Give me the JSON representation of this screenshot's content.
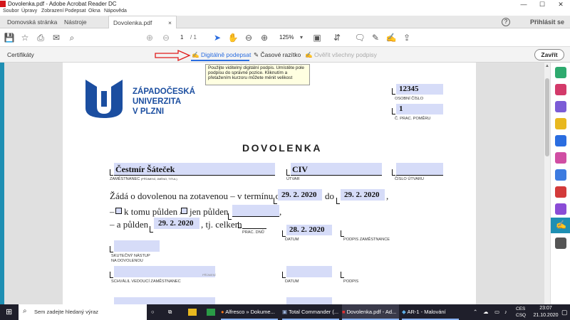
{
  "window": {
    "title": "Dovolenka.pdf - Adobe Acrobat Reader DC",
    "min": "—",
    "max": "☐",
    "close": "✕"
  },
  "menu": [
    "Soubor",
    "Úpravy",
    "Zobrazení",
    "Podepsat",
    "Okna",
    "Nápověda"
  ],
  "tabs": {
    "home": "Domovská stránka",
    "tools": "Nástroje",
    "doc": "Dovolenka.pdf",
    "doc_close": "×"
  },
  "account": {
    "help": "?",
    "signin": "Přihlásit se"
  },
  "toolbar": {
    "page_current": "1",
    "page_total": "/ 1",
    "zoom": "125%"
  },
  "certbar": {
    "label": "Certifikáty",
    "sign": "Digitálně podepsat",
    "timestamp": "Časové razítko",
    "verify": "Ověřit všechny podpisy",
    "close": "Zavřít",
    "arrow_color": "#e01b1b"
  },
  "tooltip": "Použijte viditelný digitální podpis. Umístěte pole podpisu do správné pozice. Kliknutím a přetažením kurzoru můžete měnit velikost",
  "document": {
    "logo_lines": [
      "ZÁPADOČESKÁ",
      "UNIVERZITA",
      "V PLZNI"
    ],
    "logo_color": "#1b4ea0",
    "osobni_cislo_value": "12345",
    "osobni_cislo_label": "OSOBNÍ ČÍSLO",
    "prac_pomer_value": "1",
    "prac_pomer_label": "Č. PRAC. POMĚRU",
    "heading": "DOVOLENKA",
    "zamestnanec_value": "Čestmír Šáteček",
    "zamestnanec_label": "ZAMĚSTNANEC",
    "zamestnanec_sub": "(PŘÍJMENÍ, JMÉNO, TITUL)",
    "utvar_value": "CIV",
    "utvar_label": "ÚTVAR",
    "cislo_utvaru_label": "ČÍSLO ÚTVARU",
    "line1_text": "Žádá o dovolenou na zotavenou – v termínu od",
    "date_from": "29. 2. 2020",
    "do_text": "do",
    "date_to": "29. 2. 2020",
    "comma": ",",
    "line2_prefix": "–",
    "line2_k_tomu": "k tomu půlden /",
    "line2_jen": "jen půlden",
    "line3_prefix": "– a půlden",
    "date_pulden": "29. 2. 2020",
    "celkem": ", tj. celkem",
    "prac_dnu": "PRAC. DNŮ",
    "datum_value": "28. 2. 2020",
    "datum_label": "DATUM",
    "podpis_zam_label": "PODPIS ZAMĚSTNANCE",
    "skutecny_label1": "SKUTEČNÝ NÁSTUP",
    "skutecny_label2": "NA DOVOLENOU",
    "schvalil_label": "SCHVÁLIL VEDOUCÍ ZAMĚSTNANEC",
    "schvalil_hint": "PŘÍJMENÍ",
    "datum2_label": "DATUM",
    "podpis_label": "PODPIS"
  },
  "taskbar": {
    "search": "Sem zadejte hledaný výraz",
    "apps": [
      "Alfresco » Dokume...",
      "Total Commander (...",
      "Dovolenka.pdf - Ad...",
      "AR-1 - Malování"
    ],
    "lang": "CES",
    "lang2": "CSQ",
    "time": "23:07",
    "date": "21.10.2020"
  }
}
